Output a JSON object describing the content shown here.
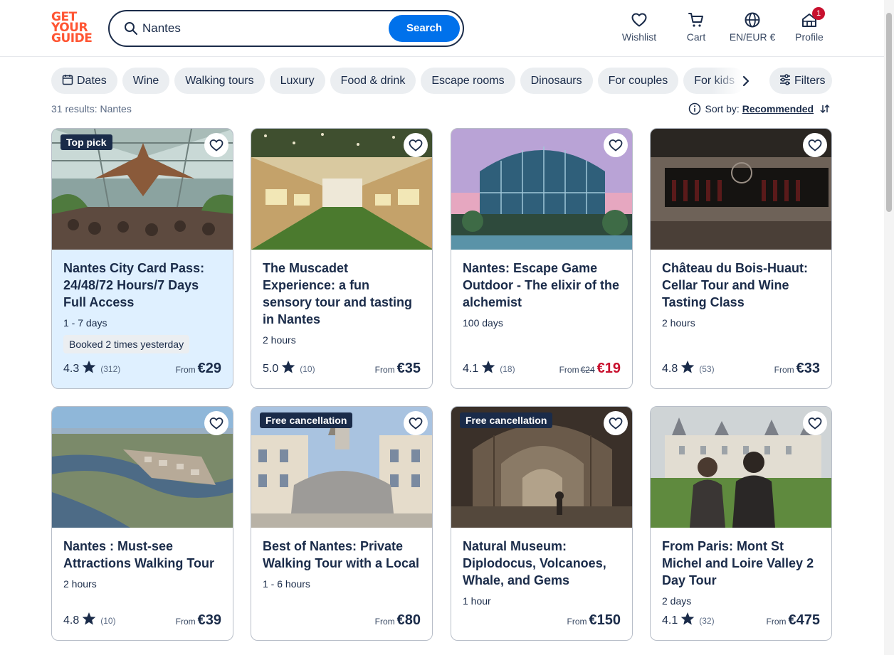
{
  "header": {
    "logo_lines": [
      "GET",
      "YOUR",
      "GUIDE"
    ],
    "search_value": "Nantes",
    "search_button": "Search",
    "nav": {
      "wishlist": "Wishlist",
      "cart": "Cart",
      "language": "EN/EUR €",
      "profile": "Profile",
      "profile_badge": "1"
    }
  },
  "filters": {
    "chips": [
      "Dates",
      "Wine",
      "Walking tours",
      "Luxury",
      "Food & drink",
      "Escape rooms",
      "Dinosaurs",
      "For couples",
      "For kids"
    ],
    "filters_label": "Filters"
  },
  "results_text": "31 results: Nantes",
  "sort": {
    "label": "Sort by:",
    "value": "Recommended"
  },
  "cards": [
    {
      "tag": "Top pick",
      "title": "Nantes City Card Pass: 24/48/72 Hours/7 Days Full Access",
      "duration": "1 - 7 days",
      "booked": "Booked 2 times yesterday",
      "rating": "4.3",
      "reviews": "(312)",
      "from": "From",
      "old_price": "",
      "price": "€29"
    },
    {
      "tag": "",
      "title": "The Muscadet Experience: a fun sensory tour and tasting in Nantes",
      "duration": "2 hours",
      "booked": "",
      "rating": "5.0",
      "reviews": "(10)",
      "from": "From",
      "old_price": "",
      "price": "€35"
    },
    {
      "tag": "",
      "title": "Nantes: Escape Game Outdoor - The elixir of the alchemist",
      "duration": "100 days",
      "booked": "",
      "rating": "4.1",
      "reviews": "(18)",
      "from": "From",
      "old_price": "€24",
      "price": "€19"
    },
    {
      "tag": "",
      "title": "Château du Bois-Huaut: Cellar Tour and Wine Tasting Class",
      "duration": "2 hours",
      "booked": "",
      "rating": "4.8",
      "reviews": "(53)",
      "from": "From",
      "old_price": "",
      "price": "€33"
    },
    {
      "tag": "",
      "title": "Nantes : Must-see Attractions Walking Tour",
      "duration": "2 hours",
      "booked": "",
      "rating": "4.8",
      "reviews": "(10)",
      "from": "From",
      "old_price": "",
      "price": "€39"
    },
    {
      "tag": "Free cancellation",
      "title": "Best of Nantes: Private Walking Tour with a Local",
      "duration": "1 - 6 hours",
      "booked": "",
      "rating": "",
      "reviews": "",
      "from": "From",
      "old_price": "",
      "price": "€80"
    },
    {
      "tag": "Free cancellation",
      "title": "Natural Museum: Diplodocus, Volcanoes, Whale, and Gems",
      "duration": "1 hour",
      "booked": "",
      "rating": "",
      "reviews": "",
      "from": "From",
      "old_price": "",
      "price": "€150"
    },
    {
      "tag": "",
      "title": "From Paris: Mont St Michel and Loire Valley 2 Day Tour",
      "duration": "2 days",
      "booked": "",
      "rating": "4.1",
      "reviews": "(32)",
      "from": "From",
      "old_price": "",
      "price": "€475"
    }
  ],
  "colors": {
    "brand": "#ff5533",
    "primary": "#0071eb",
    "navy": "#1a2b49",
    "sale": "#c8102e",
    "highlight": "#dff0ff"
  },
  "icons": [
    "search-icon",
    "heart-icon",
    "cart-icon",
    "globe-icon",
    "profile-icon",
    "calendar-icon",
    "chevron-right-icon",
    "filters-icon",
    "info-icon",
    "sort-icon",
    "star-icon"
  ]
}
